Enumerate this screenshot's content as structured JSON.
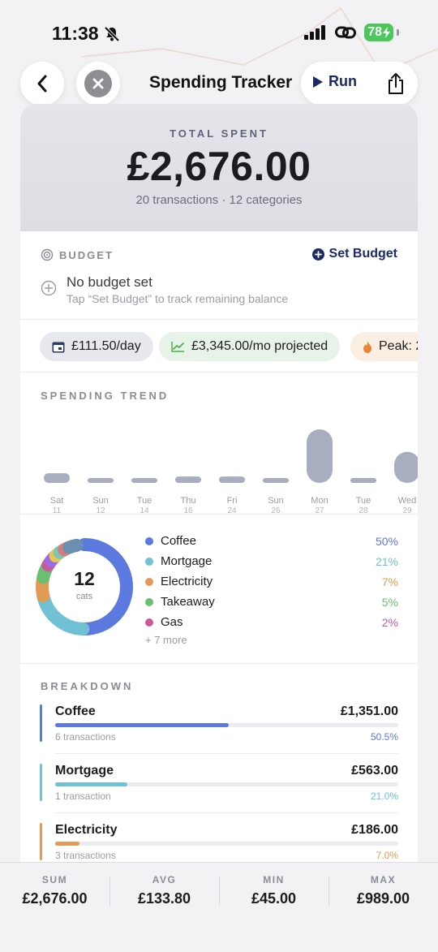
{
  "status": {
    "time": "11:38",
    "battery": "78"
  },
  "nav": {
    "title": "Spending Tracker",
    "run_label": "Run"
  },
  "summary": {
    "label": "TOTAL SPENT",
    "amount": "£2,676.00",
    "subtitle": "20 transactions · 12 categories"
  },
  "budget": {
    "label": "BUDGET",
    "action": "Set Budget",
    "title": "No budget set",
    "hint": "Tap “Set Budget” to track remaining balance"
  },
  "chips": [
    {
      "label": "£111.50/day"
    },
    {
      "label": "£3,345.00/mo projected"
    },
    {
      "label": "Peak: 2"
    }
  ],
  "trend": {
    "label": "SPENDING TREND",
    "days": [
      {
        "day": "Sat",
        "date": "11",
        "value": 0.18
      },
      {
        "day": "Sun",
        "date": "12",
        "value": 0.08
      },
      {
        "day": "Tue",
        "date": "14",
        "value": 0.08
      },
      {
        "day": "Thu",
        "date": "16",
        "value": 0.12
      },
      {
        "day": "Fri",
        "date": "24",
        "value": 0.12
      },
      {
        "day": "Sun",
        "date": "26",
        "value": 0.08
      },
      {
        "day": "Mon",
        "date": "27",
        "value": 1.0
      },
      {
        "day": "Tue",
        "date": "28",
        "value": 0.08
      },
      {
        "day": "Wed",
        "date": "29",
        "value": 0.58
      }
    ]
  },
  "categories": {
    "count": "12",
    "unit": "cats",
    "more": "+ 7 more",
    "segments": [
      0.505,
      0.21,
      0.07,
      0.05,
      0.02,
      0.025,
      0.02,
      0.02,
      0.02,
      0.03
    ],
    "segment_colors": [
      "#5b79de",
      "#6fc1d3",
      "#e39a54",
      "#6bbf72",
      "#c95b9a",
      "#a06be0",
      "#e6c84f",
      "#7ac6b8",
      "#d97a7a",
      "#6c8fb0"
    ],
    "legend": [
      {
        "name": "Coffee",
        "pct": "50%",
        "color": "#5b79de"
      },
      {
        "name": "Mortgage",
        "pct": "21%",
        "color": "#6fc1d3"
      },
      {
        "name": "Electricity",
        "pct": "7%",
        "color": "#e39a54"
      },
      {
        "name": "Takeaway",
        "pct": "5%",
        "color": "#6bbf72"
      },
      {
        "name": "Gas",
        "pct": "2%",
        "color": "#c95b9a"
      }
    ]
  },
  "breakdown": {
    "label": "BREAKDOWN",
    "items": [
      {
        "name": "Coffee",
        "amount": "£1,351.00",
        "count": "6 transactions",
        "pct": "50.5%",
        "fraction": 0.505,
        "color": "#5b79de"
      },
      {
        "name": "Mortgage",
        "amount": "£563.00",
        "count": "1 transaction",
        "pct": "21.0%",
        "fraction": 0.21,
        "color": "#6fc1d3"
      },
      {
        "name": "Electricity",
        "amount": "£186.00",
        "count": "3 transactions",
        "pct": "7.0%",
        "fraction": 0.07,
        "color": "#e39a54"
      }
    ]
  },
  "footer": [
    {
      "label": "SUM",
      "value": "£2,676.00"
    },
    {
      "label": "AVG",
      "value": "£133.80"
    },
    {
      "label": "MIN",
      "value": "£45.00"
    },
    {
      "label": "MAX",
      "value": "£989.00"
    }
  ]
}
